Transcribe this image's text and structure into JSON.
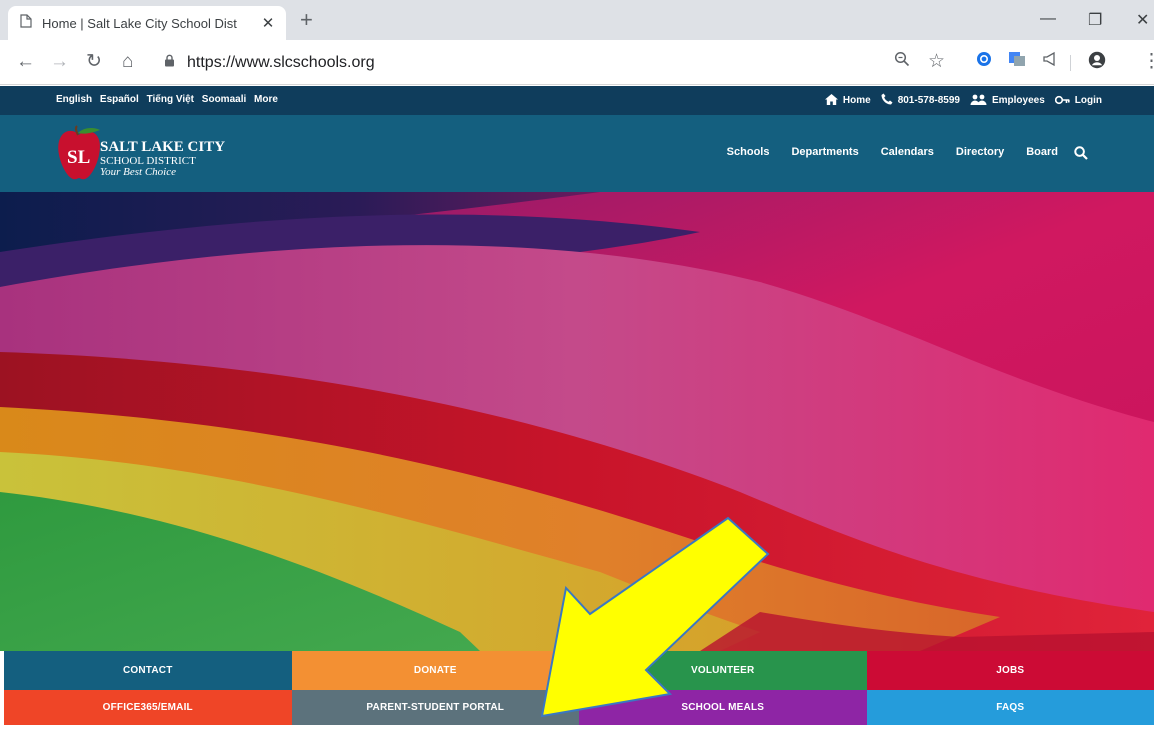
{
  "browser": {
    "tab_title": "Home | Salt Lake City School Dist",
    "tab_close": "✕",
    "new_tab": "+",
    "url": "https://www.slcschools.org",
    "window_minimize": "—",
    "window_restore": "❐",
    "window_close": "✕"
  },
  "topbar": {
    "languages": [
      "English",
      "Español",
      "Tiếng Việt",
      "Soomaali",
      "More"
    ],
    "home": "Home",
    "phone": "801-578-8599",
    "employees": "Employees",
    "login": "Login"
  },
  "logo": {
    "line1": "SALT LAKE CITY",
    "line2": "SCHOOL DISTRICT",
    "line3": "Your Best Choice",
    "badge": "SL"
  },
  "nav": {
    "items": [
      "Schools",
      "Departments",
      "Calendars",
      "Directory",
      "Board"
    ]
  },
  "quick_links": {
    "row1": [
      {
        "label": "CONTACT",
        "color": "#145f7f"
      },
      {
        "label": "DONATE",
        "color": "#f39033"
      },
      {
        "label": "VOLUNTEER",
        "color": "#28944c"
      },
      {
        "label": "JOBS",
        "color": "#cc0b35"
      }
    ],
    "row2": [
      {
        "label": "OFFICE365/EMAIL",
        "color": "#ef4527"
      },
      {
        "label": "PARENT-STUDENT PORTAL",
        "color": "#5c727c"
      },
      {
        "label": "SCHOOL MEALS",
        "color": "#8e25a5"
      },
      {
        "label": "FAQS",
        "color": "#259cdb"
      }
    ]
  },
  "colors": {
    "topbar": "#0f3d5c",
    "nav": "#145f7f",
    "arrow": "#ffff00"
  }
}
